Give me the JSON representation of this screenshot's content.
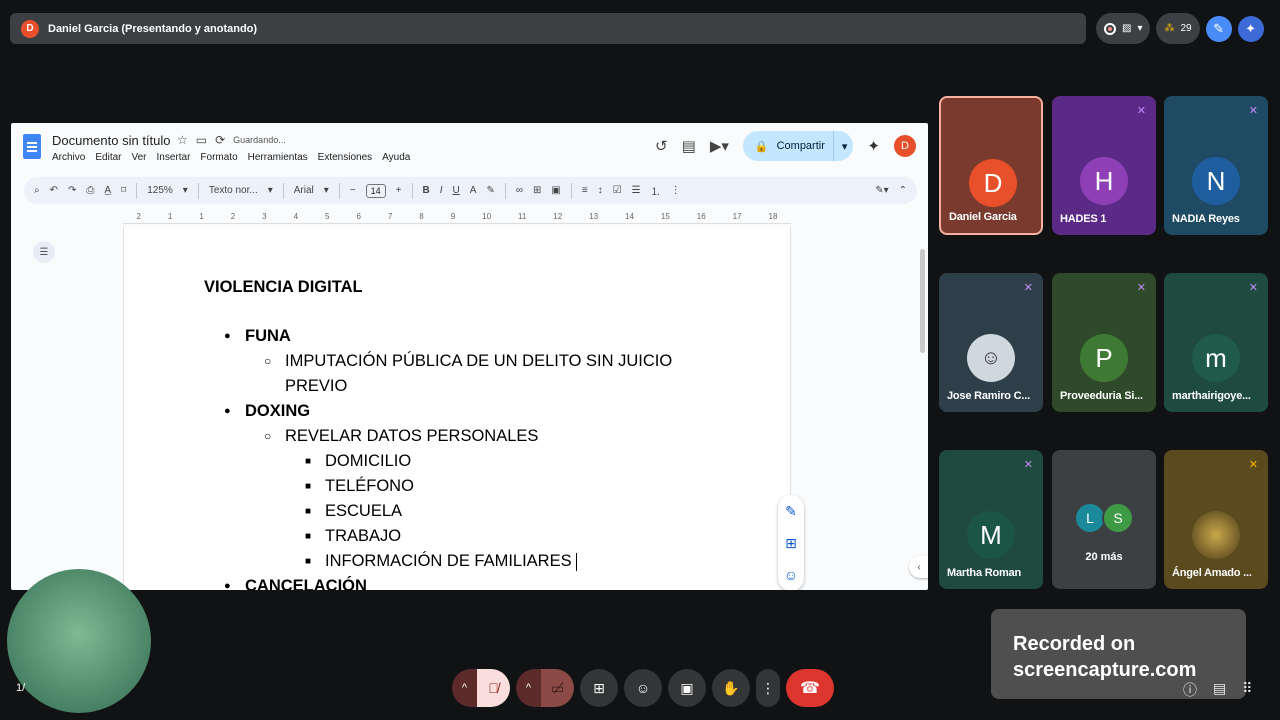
{
  "topbar": {
    "avatar": "D",
    "title": "Daniel Garcia (Presentando y anotando)"
  },
  "top_right": {
    "participants_count": "29",
    "icons": [
      "record-icon",
      "no-camera-icon",
      "chevron-down-icon",
      "people-icon",
      "pen-icon",
      "sparkle-icon"
    ]
  },
  "doc": {
    "title": "Documento sin título",
    "status": "Guardando...",
    "menus": [
      "Archivo",
      "Editar",
      "Ver",
      "Insertar",
      "Formato",
      "Herramientas",
      "Extensiones",
      "Ayuda"
    ],
    "share_label": "Compartir",
    "user_initial": "D",
    "toolbar": {
      "zoom": "125%",
      "style": "Texto nor...",
      "font": "Arial",
      "font_size": "14"
    },
    "ruler": [
      "2",
      "1",
      "1",
      "2",
      "3",
      "4",
      "5",
      "6",
      "7",
      "8",
      "9",
      "10",
      "11",
      "12",
      "13",
      "14",
      "15",
      "16",
      "17",
      "18"
    ],
    "content": {
      "heading": "VIOLENCIA DIGITAL",
      "item1": "FUNA",
      "item1_sub": "IMPUTACIÓN PÚBLICA DE UN DELITO SIN JUICIO PREVIO",
      "item2": "DOXING",
      "item2_sub": "REVELAR DATOS PERSONALES",
      "item2_list": [
        "DOMICILIO",
        "TELÉFONO",
        "ESCUELA",
        "TRABAJO",
        "INFORMACIÓN DE FAMILIARES"
      ],
      "item3": "CANCELACIÓN"
    }
  },
  "participants": [
    {
      "name": "Daniel Garcia",
      "initial": "D",
      "bg": "#7a3b2e",
      "av": "#e8502b"
    },
    {
      "name": "HADES 1",
      "initial": "H",
      "bg": "#5b2a86",
      "av": "#8e3fb5"
    },
    {
      "name": "NADIA Reyes",
      "initial": "N",
      "bg": "#1f4a63",
      "av": "#1e5e9e"
    },
    {
      "name": "Jose Ramiro C...",
      "initial": "",
      "bg": "#2f3f4a",
      "av": "#cfd8dc"
    },
    {
      "name": "Proveeduria Si...",
      "initial": "P",
      "bg": "#2f4a2a",
      "av": "#3e7a34"
    },
    {
      "name": "marthairigoye...",
      "initial": "m",
      "bg": "#1f4a40",
      "av": "#1f5a4a"
    },
    {
      "name": "Martha Roman",
      "initial": "M",
      "bg": "#1f4a40",
      "av": "#1b5546"
    },
    {
      "name": "Ángel Amado ...",
      "initial": "",
      "bg": "#5a4a1e",
      "av": "#8a7a3a"
    }
  ],
  "more": {
    "label": "20 más",
    "avatars": [
      "L",
      "S"
    ]
  },
  "self": {
    "page_count": "1/"
  },
  "watermark": {
    "line1": "Recorded on",
    "line2": "screencapture.com"
  }
}
